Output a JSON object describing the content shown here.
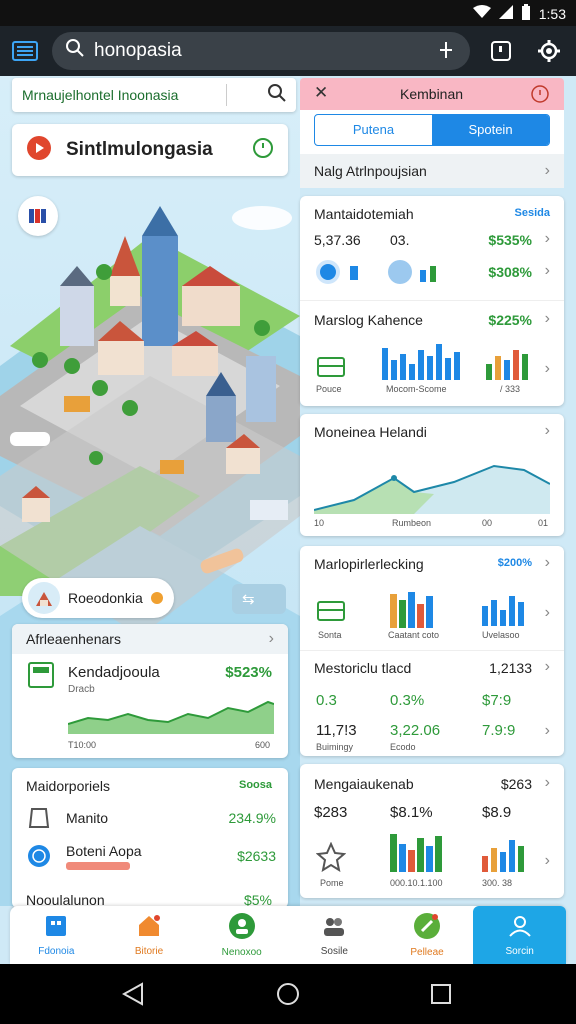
{
  "status_bar": {
    "time": "1:53"
  },
  "search": {
    "query": "honopasia"
  },
  "left_panel": {
    "header_title": "Mrnaujelhontel Inoonasia",
    "place_title": "Sintlmulongasia",
    "popup_label": "Roeodonkia",
    "stats_card": {
      "header": "Afrleaenhenars",
      "title": "Kendadjooula",
      "value": "$523%",
      "subtitle": "Dracb",
      "axis_left": "T10:00",
      "axis_right": "600"
    },
    "list_card": {
      "header": "Maidorporiels",
      "header_badge": "Soosa",
      "items": [
        {
          "label": "Manito",
          "value": "234.9%"
        },
        {
          "label": "Boteni Aopa",
          "value": "$2633",
          "tag": ""
        }
      ],
      "footer_label": "Nooulalunon",
      "footer_value": "$5%"
    }
  },
  "right_panel": {
    "header_title": "Kembinan",
    "segment_left": "Putena",
    "segment_right": "Spotein",
    "search_label": "Nalg Atrlnpoujsian",
    "card1": {
      "title": "Mantaidotemiah",
      "badge": "Sesida",
      "v1": "5,37.36",
      "v2": "03.",
      "v3": "$535%",
      "v4": "$308%",
      "row2_title": "Marslog Kahence",
      "row2_value": "$225%",
      "chart_labels": [
        "Pouce",
        "Mocom-Scome",
        "/ 333"
      ]
    },
    "card2": {
      "title": "Moneinea Helandi",
      "axis": [
        "10",
        "Rumbeon",
        "00",
        "01"
      ],
      "line_values": [
        1,
        2,
        3,
        2,
        4,
        5,
        4
      ]
    },
    "card3": {
      "title": "Marlopirlerlecking",
      "badge": "$200%",
      "chart_labels": [
        "Sonta",
        "Caatant coto",
        "Uvelasoo"
      ],
      "row2_title": "Mestoriclu tlacd",
      "row2_value": "1,2133",
      "grid": [
        "0.3",
        "0.3%",
        "$7:9",
        "11,7!3",
        "3,22.06",
        "7.9:9"
      ],
      "grid_captions": [
        "Buimingy",
        "Ecodo"
      ]
    },
    "card4": {
      "title": "Mengaiaukenab",
      "value": "$263",
      "row": [
        "$283",
        "$8.1%",
        "$8.9"
      ],
      "chart_labels": [
        "Pome",
        "000.10.1.100",
        "300. 38"
      ]
    }
  },
  "bottom_nav": {
    "items": [
      {
        "label": "Fdonoia"
      },
      {
        "label": "Bitorie"
      },
      {
        "label": "Nenoxoo"
      },
      {
        "label": "Sosile"
      },
      {
        "label": "Pelleae"
      },
      {
        "label": "Sorcin"
      }
    ]
  },
  "colors": {
    "accent": "#1e88e5",
    "green": "#2e9a3a",
    "pink_header": "#f9b7c4",
    "active_nav": "#1ea6e6"
  }
}
